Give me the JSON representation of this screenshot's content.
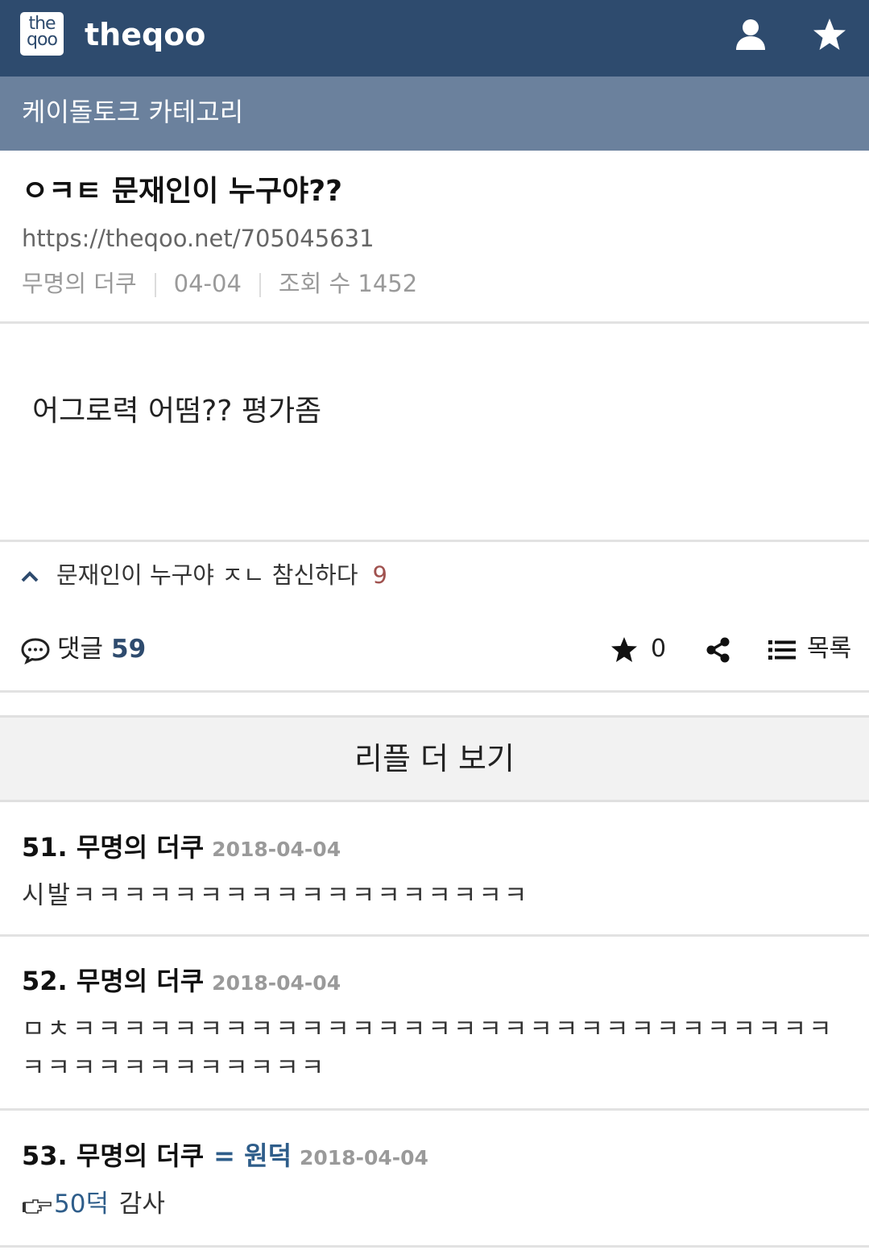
{
  "header": {
    "logo_line1": "the",
    "logo_line2": "qoo",
    "site_name": "theqoo",
    "icons": [
      "user-icon",
      "star-icon"
    ],
    "bg_color": "#2e4b6e"
  },
  "category": {
    "label": "케이돌토크 카테고리",
    "bg_color": "#6b819d"
  },
  "post": {
    "title": "ㅇㅋㅌ 문재인이 누구야??",
    "url": "https://theqoo.net/705045631",
    "author": "무명의 더쿠",
    "date": "04-04",
    "views_label": "조회 수",
    "views": "1452",
    "body": "어그로력 어떰?? 평가좀"
  },
  "related": {
    "title": "문재인이 누구야 ㅈㄴ 참신하다",
    "count": "9"
  },
  "actions": {
    "comments_label": "댓글",
    "comments_count": "59",
    "star_count": "0",
    "list_label": "목록"
  },
  "more_replies_label": "리플 더 보기",
  "replies": [
    {
      "num": "51",
      "author": "무명의 더쿠",
      "date": "2018-04-04",
      "text": "시발ㅋㅋㅋㅋㅋㅋㅋㅋㅋㅋㅋㅋㅋㅋㅋㅋㅋㅋ"
    },
    {
      "num": "52",
      "author": "무명의 더쿠",
      "date": "2018-04-04",
      "text": "ㅁㅊㅋㅋㅋㅋㅋㅋㅋㅋㅋㅋㅋㅋㅋㅋㅋㅋㅋㅋㅋㅋㅋㅋㅋㅋㅋㅋㅋㅋㅋㅋㅋㅋㅋㅋㅋㅋㅋㅋㅋㅋㅋㅋ"
    },
    {
      "num": "53",
      "author": "무명의 더쿠",
      "tag": "= 원덕",
      "date": "2018-04-04",
      "text_link": "50덕",
      "text": "감사"
    }
  ]
}
